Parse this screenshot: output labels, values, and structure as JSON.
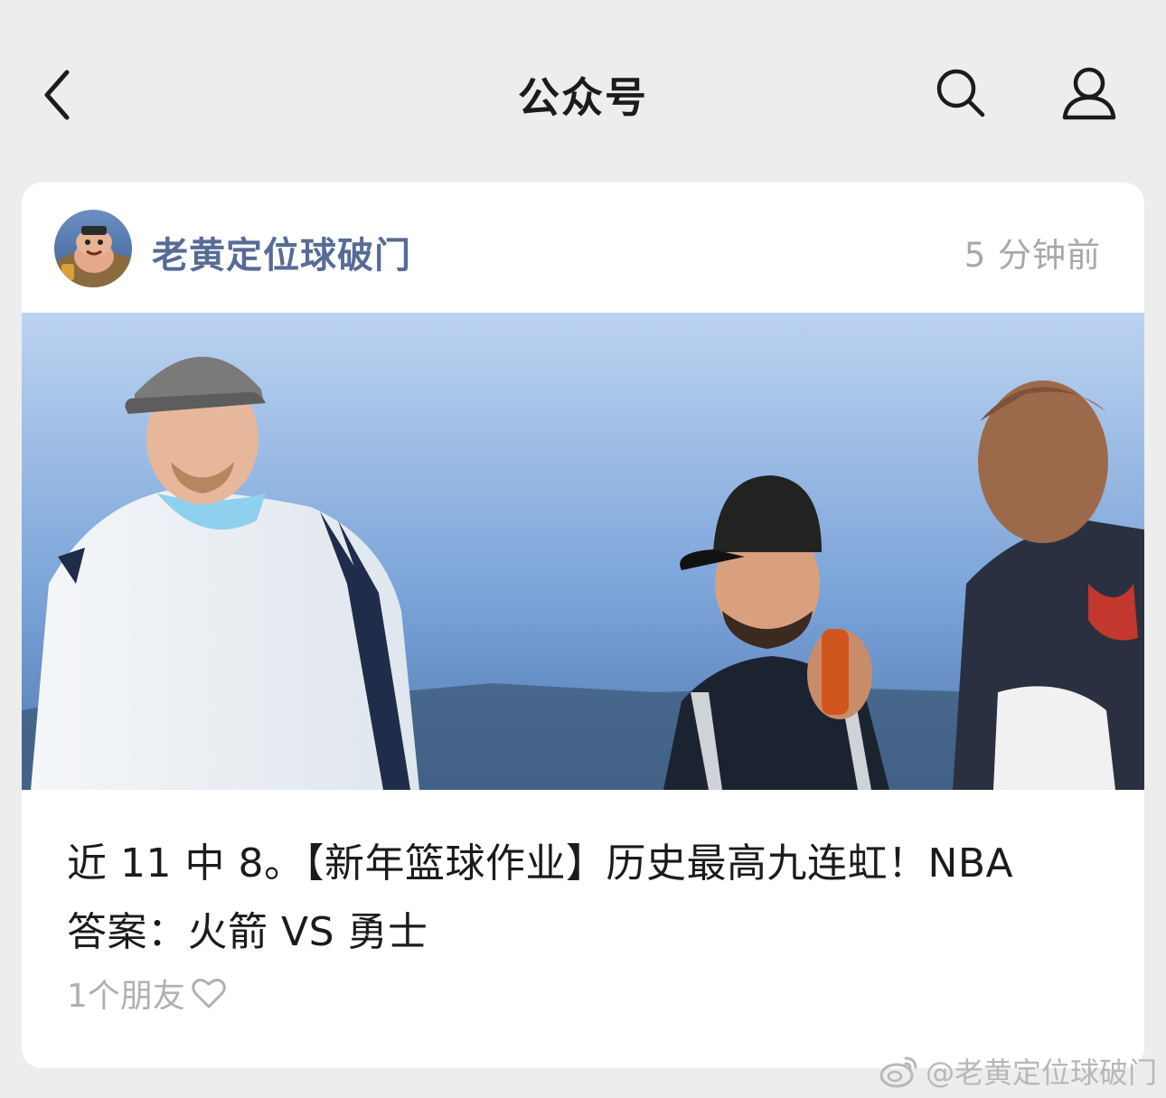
{
  "navbar": {
    "title": "公众号",
    "back_icon": "chevron-left-icon",
    "search_icon": "search-icon",
    "profile_icon": "user-icon"
  },
  "card": {
    "account_name": "老黄定位球破门",
    "timestamp": "5 分钟前",
    "cover_image": "photo of three men outdoors under blue sky",
    "title_line1": "近 11 中 8。【新年篮球作业】历史最高九连虹！NBA",
    "title_line2": "答案：火箭 VS 勇士",
    "friends_text": "1个朋友",
    "heart_icon": "heart-outline-icon"
  },
  "watermark": {
    "text": "@老黄定位球破门",
    "icon": "weibo-icon"
  },
  "colors": {
    "background": "#ededed",
    "account_link": "#576b95",
    "muted": "#a8a8a8"
  }
}
